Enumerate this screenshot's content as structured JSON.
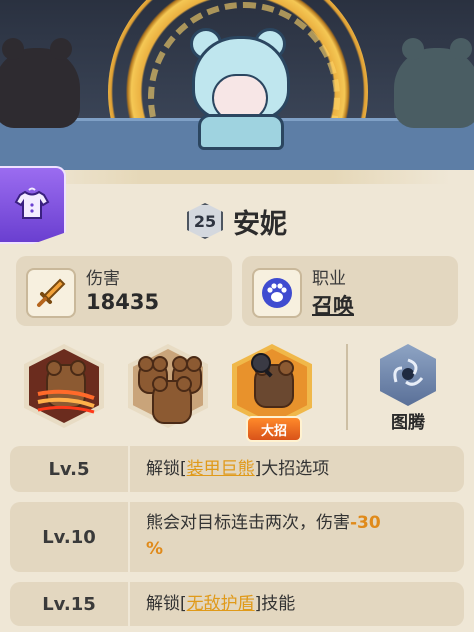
{
  "hero": {
    "character_name": "安妮",
    "level": "25",
    "outfit_icon": "shirt-icon"
  },
  "stats": [
    {
      "label": "伤害",
      "value": "18435",
      "icon": "sword-icon"
    },
    {
      "label": "职业",
      "value": "召唤",
      "icon": "paw-icon"
    }
  ],
  "skills": {
    "ultimate_tag": "大招",
    "totem_label": "图腾"
  },
  "level_unlocks": [
    {
      "level": "Lv.5",
      "prefix": "解锁",
      "bracket_open": "[",
      "highlight": "装甲巨熊",
      "bracket_close": "]",
      "suffix": "大招选项"
    },
    {
      "level": "Lv.10",
      "text": "熊会对目标连击两次，伤害",
      "value": "-30",
      "unit": "%"
    },
    {
      "level": "Lv.15",
      "prefix": "解锁",
      "bracket_open": "[",
      "highlight": "无敌护盾",
      "bracket_close": "]",
      "suffix": "技能"
    }
  ],
  "colors": {
    "panel_bg": "#efe7d6",
    "card_bg": "#e3d7c0",
    "highlight": "#e09a1a",
    "outfit_tab": "#7b4fe0",
    "ultimate_tag": "#e8641f"
  }
}
